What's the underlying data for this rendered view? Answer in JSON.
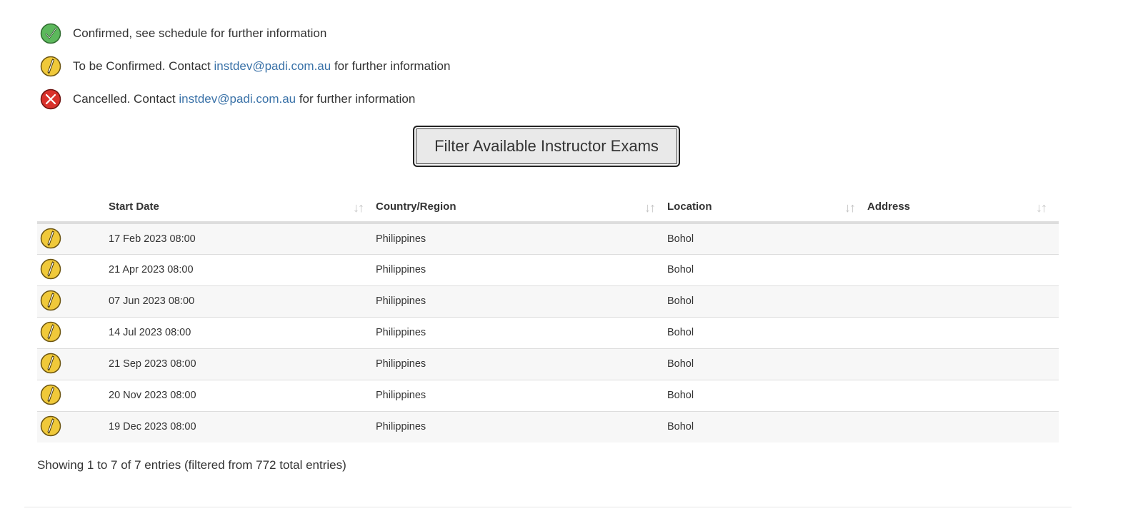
{
  "legend": {
    "confirmed": {
      "icon": "check-circle-icon",
      "text": "Confirmed, see schedule for further information"
    },
    "tbc": {
      "icon": "pencil-circle-icon",
      "text_before": "To be Confirmed. Contact ",
      "email": "instdev@padi.com.au",
      "text_after": " for further information"
    },
    "cancelled": {
      "icon": "x-circle-icon",
      "text_before": "Cancelled. Contact ",
      "email": "instdev@padi.com.au",
      "text_after": " for further information"
    }
  },
  "filter_button": {
    "label": "Filter Available Instructor Exams"
  },
  "table": {
    "headers": {
      "start_date": "Start Date",
      "country": "Country/Region",
      "location": "Location",
      "address": "Address"
    },
    "rows": [
      {
        "status": "tbc",
        "start_date": "17 Feb 2023 08:00",
        "country": "Philippines",
        "location": "Bohol",
        "address": ""
      },
      {
        "status": "tbc",
        "start_date": "21 Apr 2023 08:00",
        "country": "Philippines",
        "location": "Bohol",
        "address": ""
      },
      {
        "status": "tbc",
        "start_date": "07 Jun 2023 08:00",
        "country": "Philippines",
        "location": "Bohol",
        "address": ""
      },
      {
        "status": "tbc",
        "start_date": "14 Jul 2023 08:00",
        "country": "Philippines",
        "location": "Bohol",
        "address": ""
      },
      {
        "status": "tbc",
        "start_date": "21 Sep 2023 08:00",
        "country": "Philippines",
        "location": "Bohol",
        "address": ""
      },
      {
        "status": "tbc",
        "start_date": "20 Nov 2023 08:00",
        "country": "Philippines",
        "location": "Bohol",
        "address": ""
      },
      {
        "status": "tbc",
        "start_date": "19 Dec 2023 08:00",
        "country": "Philippines",
        "location": "Bohol",
        "address": ""
      }
    ],
    "info": "Showing 1 to 7 of 7 entries (filtered from 772 total entries)"
  },
  "colors": {
    "link": "#3a72a8",
    "confirmed": "#5cb85c",
    "tbc": "#f0c93a",
    "cancelled": "#d9312b",
    "row_stripe": "#f7f7f7"
  }
}
